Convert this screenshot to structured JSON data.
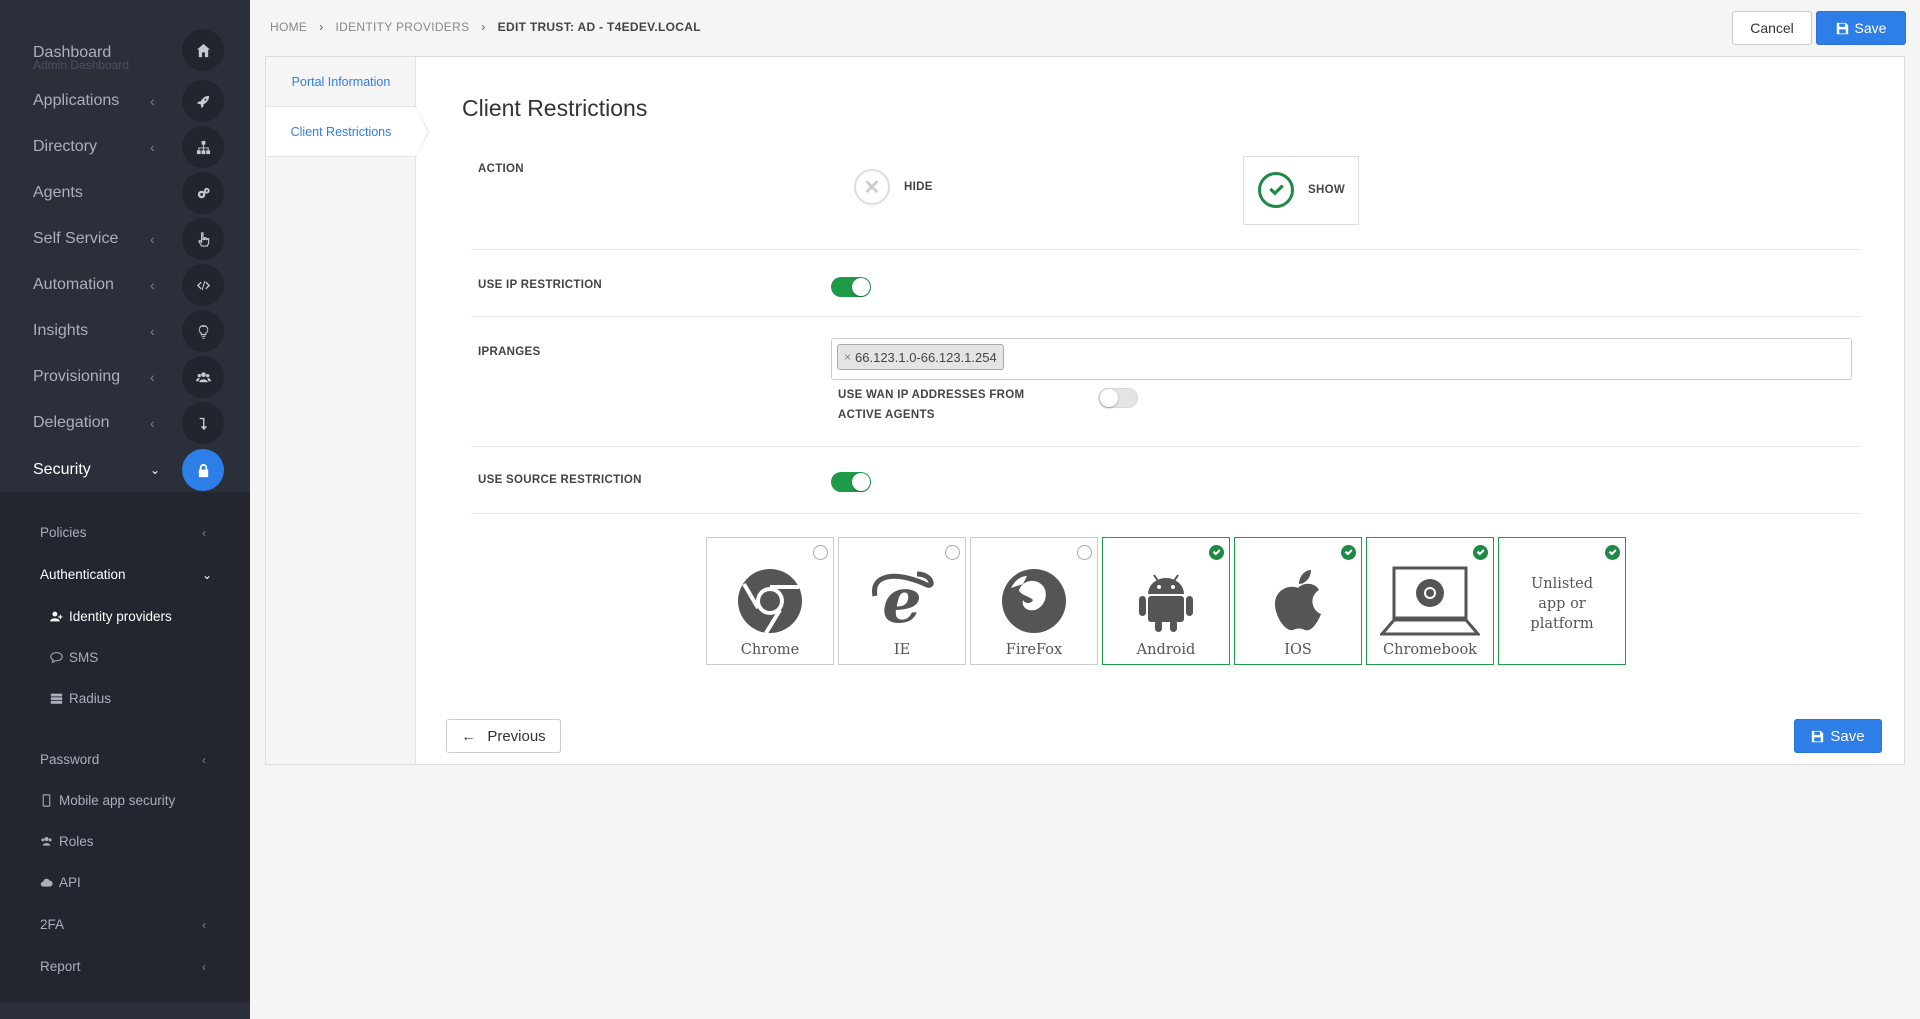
{
  "sidebar": {
    "dashboard": {
      "label": "Dashboard",
      "sub": "Admin Dashboard"
    },
    "items": [
      {
        "label": "Applications"
      },
      {
        "label": "Directory"
      },
      {
        "label": "Agents"
      },
      {
        "label": "Self Service"
      },
      {
        "label": "Automation"
      },
      {
        "label": "Insights"
      },
      {
        "label": "Provisioning"
      },
      {
        "label": "Delegation"
      },
      {
        "label": "Security"
      }
    ],
    "submenu": {
      "policies": "Policies",
      "authentication": "Authentication",
      "identity_providers": "Identity providers",
      "sms": "SMS",
      "radius": "Radius",
      "password": "Password",
      "mobile_app_security": "Mobile app security",
      "roles": "Roles",
      "api": "API",
      "twofa": "2FA",
      "report": "Report"
    }
  },
  "breadcrumb": {
    "home": "HOME",
    "identity_providers": "IDENTITY PROVIDERS",
    "current": "EDIT TRUST: AD - T4EDEV.LOCAL"
  },
  "toolbar": {
    "cancel_label": "Cancel",
    "save_label": "Save"
  },
  "tabs": [
    {
      "label": "Portal Information"
    },
    {
      "label": "Client Restrictions"
    }
  ],
  "content": {
    "title": "Client Restrictions",
    "action": {
      "label": "ACTION",
      "hide": "HIDE",
      "show": "SHOW",
      "selected": "SHOW"
    },
    "ip_restriction": {
      "label": "USE IP RESTRICTION",
      "enabled": true
    },
    "ipranges": {
      "label": "IPRANGES",
      "tags": [
        "66.123.1.0-66.123.1.254"
      ],
      "wan_label": "USE WAN IP ADDRESSES FROM ACTIVE AGENTS",
      "wan_enabled": false
    },
    "source_restriction": {
      "label": "USE SOURCE RESTRICTION",
      "enabled": true
    },
    "clients": [
      {
        "label": "Chrome",
        "checked": false,
        "icon": "chrome-icon"
      },
      {
        "label": "IE",
        "checked": false,
        "icon": "ie-icon"
      },
      {
        "label": "FireFox",
        "checked": false,
        "icon": "firefox-icon"
      },
      {
        "label": "Android",
        "checked": true,
        "icon": "android-icon"
      },
      {
        "label": "IOS",
        "checked": true,
        "icon": "apple-icon"
      },
      {
        "label": "Chromebook",
        "checked": true,
        "icon": "chromebook-icon"
      },
      {
        "label_lines": [
          "Unlisted",
          "app or",
          "platform"
        ],
        "checked": true
      }
    ],
    "previous_label": "Previous",
    "save_label": "Save"
  },
  "colors": {
    "accent": "#2d7ee6",
    "success": "#1e8a45",
    "sidebar_bg": "#2b2f3a"
  }
}
